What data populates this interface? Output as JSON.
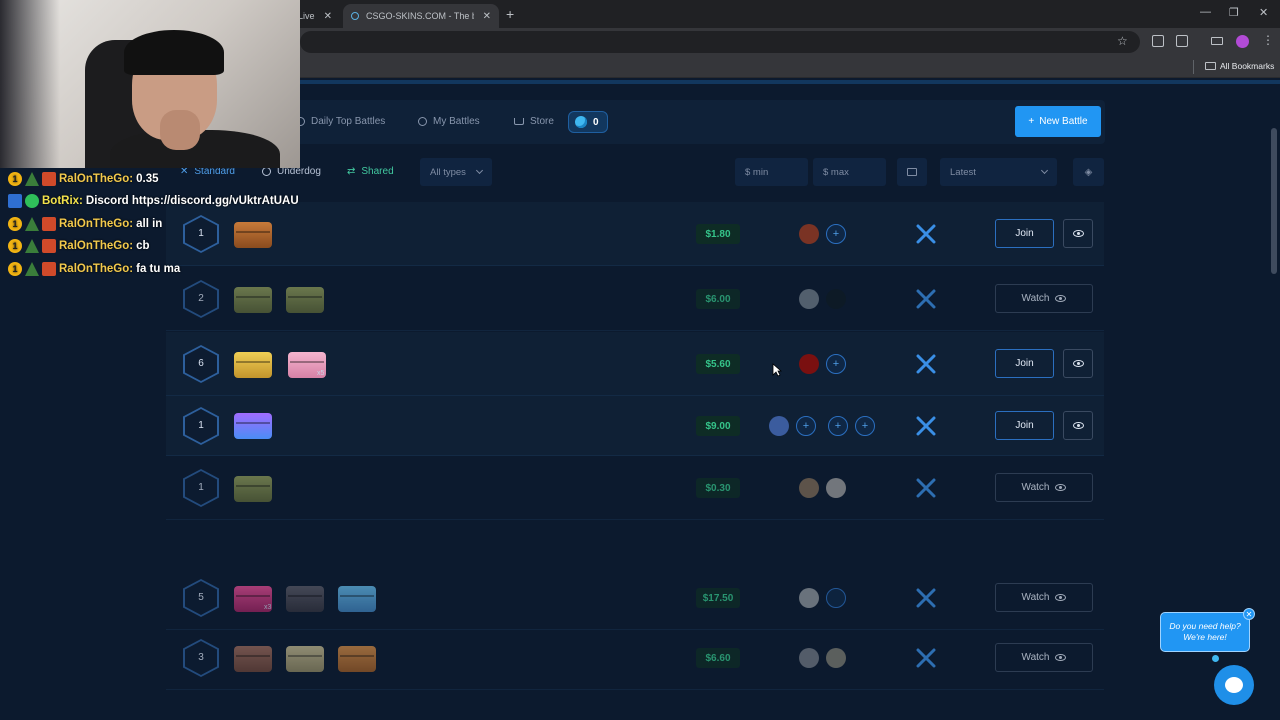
{
  "browser": {
    "tabs": [
      {
        "label": "Live"
      },
      {
        "label": "CSGO-SKINS.COM - The best C"
      }
    ],
    "bookmarks_label": "All Bookmarks"
  },
  "nav": {
    "items": [
      {
        "label": "Daily Top Battles",
        "icon": "trophy-icon"
      },
      {
        "label": "My Battles",
        "icon": "history-icon"
      },
      {
        "label": "Store",
        "icon": "basket-icon"
      }
    ],
    "coin_count": "0",
    "new_battle_label": "New Battle"
  },
  "filters": {
    "modes": [
      {
        "label": "Standard",
        "color": "#4f9ee8"
      },
      {
        "label": "Underdog",
        "color": "#b8c3d6"
      },
      {
        "label": "Shared",
        "color": "#42c9a0"
      }
    ],
    "type_select": "All types",
    "min_placeholder": "$ min",
    "max_placeholder": "$ max",
    "sort_select": "Latest"
  },
  "battles": [
    {
      "rounds": "1",
      "price": "$1.80",
      "action": "Join"
    },
    {
      "rounds": "2",
      "price": "$6.00",
      "action": "Watch"
    },
    {
      "rounds": "6",
      "price": "$5.60",
      "action": "Join",
      "multiplier": "x5"
    },
    {
      "rounds": "1",
      "price": "$9.00",
      "action": "Join"
    },
    {
      "rounds": "1",
      "price": "$0.30",
      "action": "Watch"
    },
    {
      "rounds": "5",
      "price": "$17.50",
      "action": "Watch",
      "multiplier": "x3"
    },
    {
      "rounds": "3",
      "price": "$6.60",
      "action": "Watch"
    }
  ],
  "chat": [
    {
      "user": "RalOnTheGo:",
      "text": "0.35"
    },
    {
      "user": "BotRix:",
      "text": "Discord https://discord.gg/vUktrAtUAU"
    },
    {
      "user": "RalOnTheGo:",
      "text": "all in"
    },
    {
      "user": "RalOnTheGo:",
      "text": "cb"
    },
    {
      "user": "RalOnTheGo:",
      "text": "fa tu ma"
    }
  ],
  "help": {
    "line1": "Do you need help?",
    "line2": "We're here!"
  }
}
